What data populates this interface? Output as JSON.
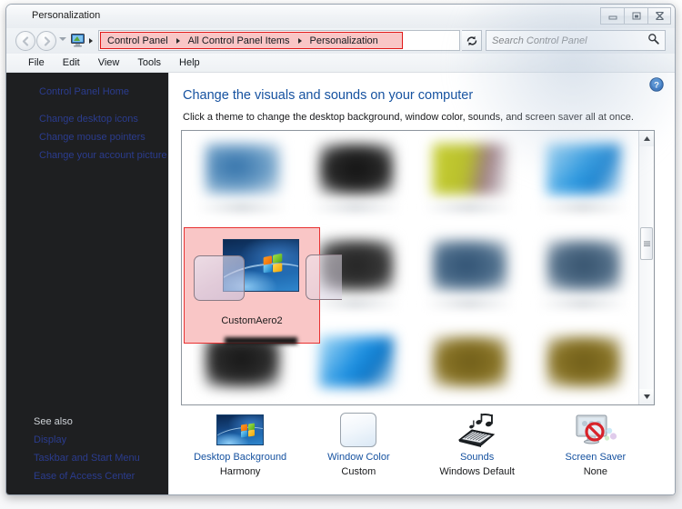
{
  "window": {
    "title": "Personalization",
    "controls": {
      "minimize": "minimize-button",
      "maximize": "maximize-button",
      "close": "close-button"
    }
  },
  "navigation": {
    "back_label": "Back",
    "forward_label": "Forward",
    "recent_pages_label": "Recent pages",
    "breadcrumbs": [
      "Control Panel",
      "All Control Panel Items",
      "Personalization"
    ],
    "address_dropdown_label": "Previous locations",
    "refresh_label": "Refresh",
    "highlight_color": "#e01717",
    "highlight_fill": "#f9c6c6"
  },
  "search": {
    "placeholder": "Search Control Panel",
    "value": ""
  },
  "menubar": {
    "items": [
      "File",
      "Edit",
      "View",
      "Tools",
      "Help"
    ]
  },
  "sidebar": {
    "home_label": "Control Panel Home",
    "tasks": [
      "Change desktop icons",
      "Change mouse pointers",
      "Change your account picture"
    ],
    "see_also_label": "See also",
    "see_also": [
      "Display",
      "Taskbar and Start Menu",
      "Ease of Access Center"
    ]
  },
  "main": {
    "help_label": "Help",
    "title": "Change the visuals and sounds on your computer",
    "subtitle": "Click a theme to change the desktop background, window color, sounds, and screen saver all at once.",
    "selected_theme": {
      "name": "CustomAero2",
      "highlight_border": "#e83030",
      "highlight_fill": "#f9c6c6"
    },
    "theme_thumbnails": [
      {
        "row": 1,
        "col": 1,
        "color": "#2f6fa8"
      },
      {
        "row": 1,
        "col": 2,
        "color": "#1d1d1d"
      },
      {
        "row": 1,
        "col": 3,
        "color": "#b9c22b"
      },
      {
        "row": 1,
        "col": 4,
        "color": "#2a98e0"
      },
      {
        "row": 2,
        "col": 1,
        "color": "#1f4f87"
      },
      {
        "row": 2,
        "col": 2,
        "color": "#3a3a3a"
      },
      {
        "row": 2,
        "col": 3,
        "color": "#3e5b78"
      },
      {
        "row": 2,
        "col": 4,
        "color": "#3d5770"
      },
      {
        "row": 3,
        "col": 1,
        "color": "#242424"
      },
      {
        "row": 3,
        "col": 2,
        "color": "#1a8ee0"
      },
      {
        "row": 3,
        "col": 3,
        "color": "#7d6a22"
      },
      {
        "row": 3,
        "col": 4,
        "color": "#7e6a23"
      }
    ],
    "scrollbar": {
      "up_label": "Scroll up",
      "down_label": "Scroll down",
      "thumb_label": "Scroll thumb"
    },
    "settings": [
      {
        "icon": "desktop-background-icon",
        "link": "Desktop Background",
        "value": "Harmony"
      },
      {
        "icon": "window-color-icon",
        "link": "Window Color",
        "value": "Custom"
      },
      {
        "icon": "sounds-icon",
        "link": "Sounds",
        "value": "Windows Default"
      },
      {
        "icon": "screen-saver-icon",
        "link": "Screen Saver",
        "value": "None"
      }
    ]
  },
  "colors": {
    "link_blue": "#1652a0",
    "title_blue": "#1652a0",
    "sidebar_bg": "#1e1f21",
    "sidebar_link": "#2b3c8e"
  }
}
